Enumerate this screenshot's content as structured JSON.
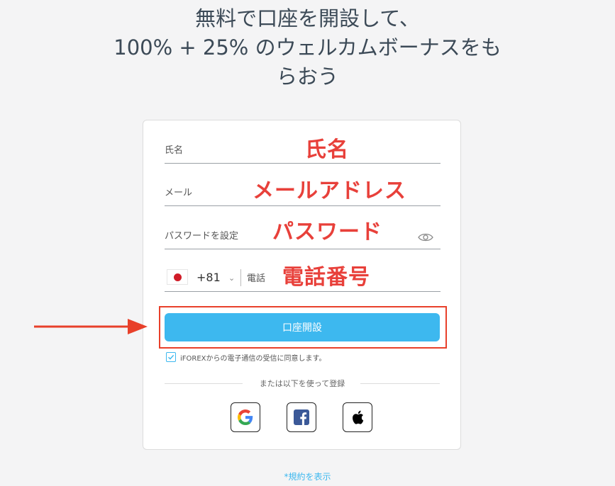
{
  "headline": {
    "line1": "無料で口座を開設して、",
    "line2": "100% + 25% のウェルカムボーナスをも",
    "line3": "らおう"
  },
  "form": {
    "name_label": "氏名",
    "email_label": "メール",
    "password_label": "パスワードを設定",
    "phone": {
      "country_flag": "japan-flag",
      "dial_code": "+81",
      "label": "電話"
    },
    "submit_label": "口座開設",
    "consent_text": "iFOREXからの電子通信の受信に同意します。",
    "consent_checked": true,
    "divider_text": "または以下を使って登録",
    "social_buttons": [
      "google-icon",
      "facebook-icon",
      "apple-icon"
    ]
  },
  "annotations": {
    "name": "氏名",
    "email": "メールアドレス",
    "password": "パスワード",
    "phone": "電話番号",
    "color": "#e8403a"
  },
  "footer": {
    "terms_link": "*規約を表示"
  },
  "colors": {
    "accent": "#3db8ef",
    "annotation_red": "#e8403a"
  }
}
